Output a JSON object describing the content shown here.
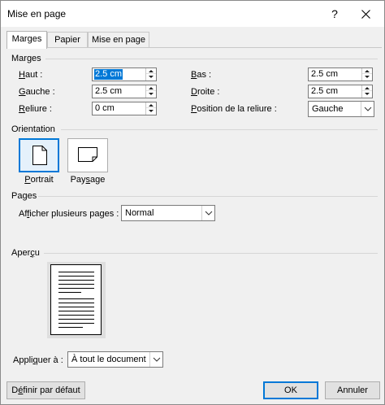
{
  "window": {
    "title": "Mise en page",
    "help_label": "?"
  },
  "tabs": [
    {
      "label": "Marges",
      "active": true
    },
    {
      "label": "Papier",
      "active": false
    },
    {
      "label": "Mise en page",
      "active": false
    }
  ],
  "margins": {
    "section_title": "Marges",
    "top": {
      "label_key": "H",
      "label_rest": "aut :",
      "value": "2.5 cm"
    },
    "bottom": {
      "label_key": "B",
      "label_rest": "as :",
      "value": "2.5 cm"
    },
    "left": {
      "label_key": "G",
      "label_rest": "auche :",
      "value": "2.5 cm"
    },
    "right": {
      "label_key": "D",
      "label_rest": "roite :",
      "value": "2.5 cm"
    },
    "gutter": {
      "label_key": "R",
      "label_rest": "eliure :",
      "value": "0 cm"
    },
    "gutter_position": {
      "label_key": "P",
      "label_rest": "osition de la reliure :",
      "value": "Gauche"
    }
  },
  "orientation": {
    "section_title": "Orientation",
    "portrait": {
      "label_key": "P",
      "label_rest": "ortrait",
      "selected": true
    },
    "landscape": {
      "label_pre": "Pay",
      "label_key": "s",
      "label_rest": "age",
      "selected": false
    }
  },
  "pages": {
    "section_title": "Pages",
    "multiple_label_pre": "Af",
    "multiple_label_key": "f",
    "multiple_label_rest": "icher plusieurs pages :",
    "multiple_value": "Normal"
  },
  "preview": {
    "section_title_pre": "Aper",
    "section_title_key": "ç",
    "section_title_rest": "u"
  },
  "apply": {
    "label_pre": "Appli",
    "label_key": "q",
    "label_rest": "uer à :",
    "value": "À tout le document"
  },
  "buttons": {
    "default_pre": "D",
    "default_key": "é",
    "default_rest": "finir par défaut",
    "ok": "OK",
    "cancel": "Annuler"
  },
  "colors": {
    "accent": "#0078d7",
    "background": "#f0f0f0"
  }
}
